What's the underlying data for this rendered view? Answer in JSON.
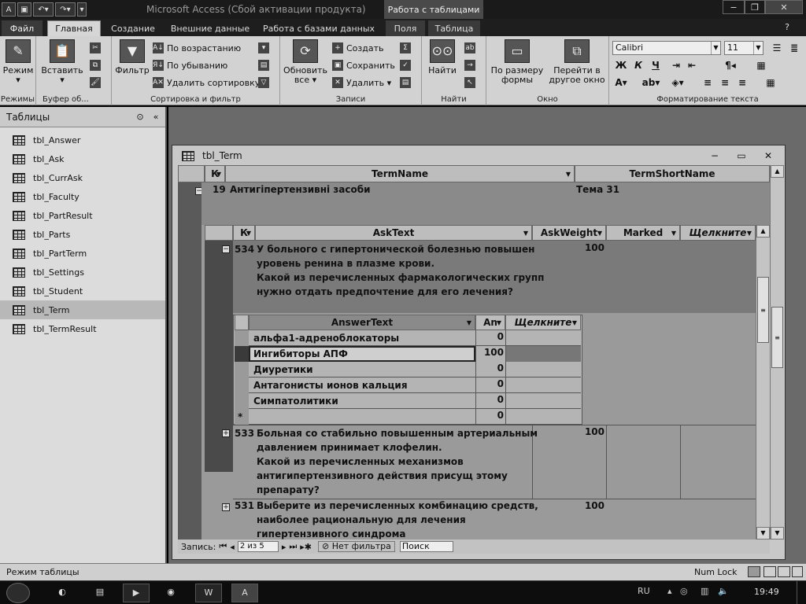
{
  "window": {
    "title": "Microsoft Access (Сбой активации продукта)",
    "context_tab_group": "Работа с таблицами"
  },
  "ribbon_tabs": [
    "Файл",
    "Главная",
    "Создание",
    "Внешние данные",
    "Работа с базами данных",
    "Поля",
    "Таблица"
  ],
  "ribbon": {
    "views": {
      "mode_label": "Режим",
      "group": "Режимы"
    },
    "clipboard": {
      "paste_label": "Вставить",
      "group": "Буфер об..."
    },
    "sort_filter": {
      "filter_label": "Фильтр",
      "sort_asc": "По возрастанию",
      "sort_desc": "По убыванию",
      "remove_sort": "Удалить сортировку",
      "group": "Сортировка и фильтр"
    },
    "records": {
      "refresh_label": "Обновить все",
      "create": "Создать",
      "save": "Сохранить",
      "delete": "Удалить",
      "group": "Записи"
    },
    "find": {
      "find_label": "Найти",
      "group": "Найти"
    },
    "window": {
      "fit_form": "По размеру формы",
      "switch_windows": "Перейти в другое окно",
      "group": "Окно"
    },
    "text_format": {
      "font": "Calibri",
      "size": "11",
      "group": "Форматирование текста"
    }
  },
  "nav": {
    "header": "Таблицы",
    "items": [
      "tbl_Answer",
      "tbl_Ask",
      "tbl_CurrAsk",
      "tbl_Faculty",
      "tbl_PartResult",
      "tbl_Parts",
      "tbl_PartTerm",
      "tbl_Settings",
      "tbl_Student",
      "tbl_Term",
      "tbl_TermResult"
    ],
    "selected": "tbl_Term"
  },
  "doc": {
    "title": "tbl_Term",
    "level1": {
      "headers": {
        "key": "К",
        "term_name": "TermName",
        "term_short": "TermShortName"
      },
      "row": {
        "id": "19",
        "term_name": "Антигіпертензивні засоби",
        "term_short": "Тема 31"
      }
    },
    "level2": {
      "headers": {
        "key": "К",
        "ask_text": "AskText",
        "ask_weight": "AskWeight",
        "marked": "Marked",
        "click_to_add": "Щелкните"
      },
      "rows": [
        {
          "id": "534",
          "lines": [
            "У больного с гипертонической болезнью повышен",
            "уровень ренина в плазме крови.",
            "Какой из перечисленных фармакологических групп",
            "нужно отдать предпочтение для его лечения?"
          ],
          "weight": "100"
        },
        {
          "id": "533",
          "lines": [
            "Больная со стабильно повышенным артериальным",
            "давлением принимает клофелин.",
            "Какой из перечисленных механизмов",
            "антигипертензивного действия присущ этому",
            "препарату?"
          ],
          "weight": "100"
        },
        {
          "id": "531",
          "lines": [
            "Выберите из перечисленных комбинацию средств,",
            "наиболее рациональную для лечения",
            "гипертензивного синдрома"
          ],
          "weight": "100"
        }
      ]
    },
    "level3": {
      "headers": {
        "answer_text": "AnswerText",
        "answer_num": "An",
        "click_to_add": "Щелкните"
      },
      "rows": [
        {
          "text": "альфа1-адреноблокаторы",
          "value": "0"
        },
        {
          "text": "Ингибиторы АПФ",
          "value": "100"
        },
        {
          "text": "Диуретики",
          "value": "0"
        },
        {
          "text": "Антагонисты ионов кальция",
          "value": "0"
        },
        {
          "text": "Симпатолитики",
          "value": "0"
        }
      ],
      "new_row": {
        "marker": "*",
        "value": "0"
      }
    },
    "record_nav": {
      "label": "Запись:",
      "position": "2 из 5",
      "filter": "Нет фильтра",
      "search_placeholder": "Поиск"
    }
  },
  "status": {
    "mode": "Режим таблицы",
    "numlock": "Num Lock"
  },
  "taskbar": {
    "lang": "RU",
    "time": "19:49"
  }
}
